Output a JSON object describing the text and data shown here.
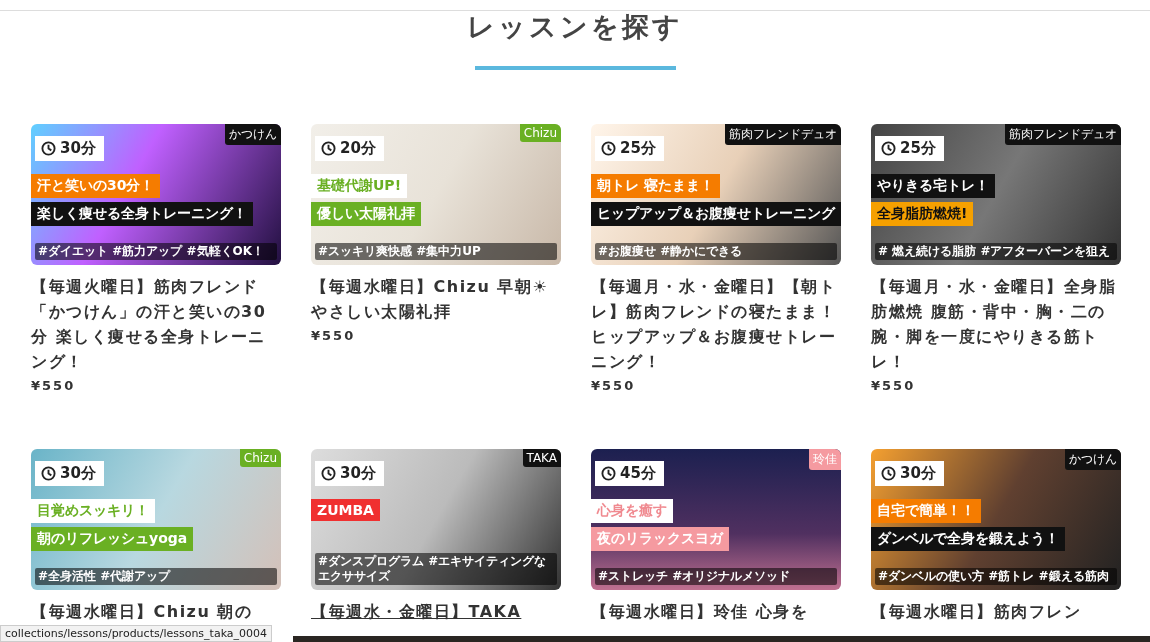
{
  "heading": "レッスンを探す",
  "lessons": [
    {
      "thumbnail": {
        "duration": "30分",
        "instructor": {
          "text": "かつけん",
          "color": "#111111"
        },
        "headline": [
          {
            "text": "汗と笑いの30分！",
            "kind": "filled",
            "color": "#f57c00"
          },
          {
            "text": "楽しく痩せる全身トレーニング！",
            "kind": "filled",
            "color": "#111111"
          }
        ],
        "hashtags": "#ダイエット #筋力アップ #気軽くOK！"
      },
      "title": "【毎週火曜日】筋肉フレンド「かつけん」の汗と笑いの30分 楽しく痩せる全身トレーニング！",
      "price": "¥550",
      "hovered": false
    },
    {
      "thumbnail": {
        "duration": "20分",
        "instructor": {
          "text": "Chizu",
          "color": "#6ab023"
        },
        "headline": [
          {
            "text": "基礎代謝UP!",
            "kind": "light",
            "color": "#6ab023"
          },
          {
            "text": "優しい太陽礼拝",
            "kind": "filled",
            "color": "#6ab023"
          }
        ],
        "hashtags": "#スッキリ爽快感 #集中力UP"
      },
      "title": "【毎週水曜日】Chizu 早朝☀やさしい太陽礼拝",
      "price": "¥550",
      "hovered": false
    },
    {
      "thumbnail": {
        "duration": "25分",
        "instructor": {
          "text": "筋肉フレンドデュオ",
          "color": "#111111"
        },
        "headline": [
          {
            "text": "朝トレ 寝たまま！",
            "kind": "filled",
            "color": "#f57c00"
          },
          {
            "text": "ヒップアップ＆お腹痩せトレーニング",
            "kind": "filled",
            "color": "#111111"
          }
        ],
        "hashtags": "#お腹痩せ #静かにできる"
      },
      "title": "【毎週月・水・金曜日】【朝トレ】筋肉フレンドの寝たまま！ヒップアップ＆お腹痩せトレーニング！",
      "price": "¥550",
      "hovered": false
    },
    {
      "thumbnail": {
        "duration": "25分",
        "instructor": {
          "text": "筋肉フレンドデュオ",
          "color": "#111111"
        },
        "headline": [
          {
            "text": "やりきる宅トレ！",
            "kind": "filled",
            "color": "#111111"
          },
          {
            "text": "全身脂肪燃焼!",
            "kind": "dark-text",
            "color": "#f5a000"
          }
        ],
        "hashtags": "# 燃え続ける脂肪 #アフターバーンを狙え"
      },
      "title": "【毎週月・水・金曜日】全身脂肪燃焼 腹筋・背中・胸・二の腕・脚を一度にやりきる筋トレ！",
      "price": "¥550",
      "hovered": false
    },
    {
      "thumbnail": {
        "duration": "30分",
        "instructor": {
          "text": "Chizu",
          "color": "#6ab023"
        },
        "headline": [
          {
            "text": "目覚めスッキリ！",
            "kind": "light",
            "color": "#6ab023"
          },
          {
            "text": "朝のリフレッシュyoga",
            "kind": "filled",
            "color": "#6ab023"
          }
        ],
        "hashtags": "#全身活性 #代謝アップ"
      },
      "title": "【毎週水曜日】Chizu 朝の",
      "hovered": false
    },
    {
      "thumbnail": {
        "duration": "30分",
        "instructor": {
          "text": "TAKA",
          "color": "#111111"
        },
        "headline": [
          {
            "text": "ZUMBA",
            "kind": "filled",
            "color": "#f03030"
          }
        ],
        "hashtags": "#ダンスプログラム #エキサイティングなエクササイズ"
      },
      "title": "【毎週水・金曜日】TAKA",
      "hovered": true
    },
    {
      "thumbnail": {
        "duration": "45分",
        "instructor": {
          "text": "玲佳",
          "color": "#f59aa0"
        },
        "headline": [
          {
            "text": "心身を癒す",
            "kind": "light",
            "color": "#f08a90"
          },
          {
            "text": "夜のリラックスヨガ",
            "kind": "filled",
            "color": "#f59aa0"
          }
        ],
        "hashtags": "#ストレッチ #オリジナルメソッド"
      },
      "title": "【毎週水曜日】玲佳 心身を",
      "hovered": false
    },
    {
      "thumbnail": {
        "duration": "30分",
        "instructor": {
          "text": "かつけん",
          "color": "#111111"
        },
        "headline": [
          {
            "text": "自宅で簡単！！",
            "kind": "filled",
            "color": "#f57c00"
          },
          {
            "text": "ダンベルで全身を鍛えよう！",
            "kind": "filled",
            "color": "#111111"
          }
        ],
        "hashtags": "#ダンベルの使い方 #筋トレ #鍛える筋肉"
      },
      "title": "【毎週水曜日】筋肉フレン",
      "hovered": false
    }
  ],
  "status_url": "collections/lessons/products/lessons_taka_0004"
}
